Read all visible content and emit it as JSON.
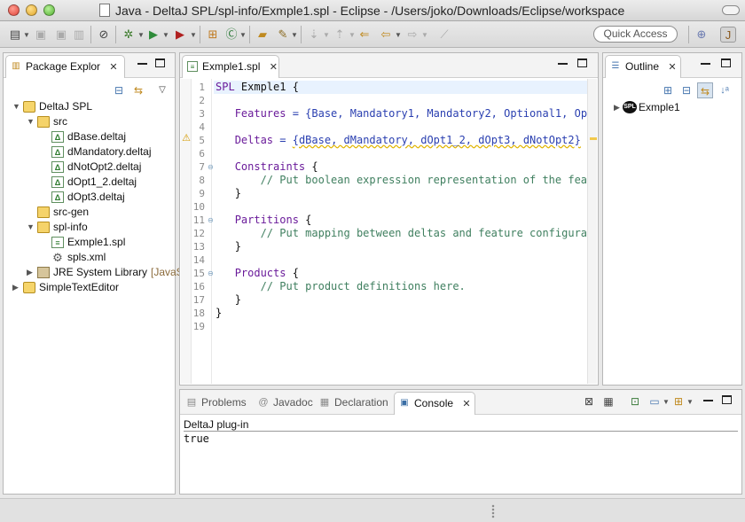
{
  "window": {
    "title": "Java - DeltaJ SPL/spl-info/Exmple1.spl - Eclipse - /Users/joko/Downloads/Eclipse/workspace"
  },
  "toolbar": {
    "quick_access_label": "Quick Access"
  },
  "package_explorer": {
    "tab_label": "Package Explor",
    "tree": [
      {
        "label": "DeltaJ SPL",
        "icon": "project-icon",
        "level": 0,
        "expanded": true
      },
      {
        "label": "src",
        "icon": "source-folder-icon",
        "level": 1,
        "expanded": true
      },
      {
        "label": "dBase.deltaj",
        "icon": "deltaj-file-icon",
        "level": 2
      },
      {
        "label": "dMandatory.deltaj",
        "icon": "deltaj-file-icon",
        "level": 2
      },
      {
        "label": "dNotOpt2.deltaj",
        "icon": "deltaj-file-icon",
        "level": 2
      },
      {
        "label": "dOpt1_2.deltaj",
        "icon": "deltaj-file-icon",
        "level": 2
      },
      {
        "label": "dOpt3.deltaj",
        "icon": "deltaj-file-icon",
        "level": 2
      },
      {
        "label": "src-gen",
        "icon": "source-folder-icon",
        "level": 1
      },
      {
        "label": "spl-info",
        "icon": "source-folder-icon",
        "level": 1,
        "expanded": true
      },
      {
        "label": "Exmple1.spl",
        "icon": "spl-file-icon",
        "level": 2
      },
      {
        "label": "spls.xml",
        "icon": "gear-icon",
        "level": 2
      },
      {
        "label": "JRE System Library",
        "suffix": "[JavaSE",
        "icon": "library-icon",
        "level": 1,
        "collapsed": true
      },
      {
        "label": "SimpleTextEditor",
        "icon": "project-icon",
        "level": 0,
        "collapsed": true
      }
    ]
  },
  "editor": {
    "tab_label": "Exmple1.spl",
    "line_numbers": [
      "1",
      "2",
      "3",
      "4",
      "5",
      "6",
      "7",
      "8",
      "9",
      "10",
      "11",
      "12",
      "13",
      "14",
      "15",
      "16",
      "17",
      "18",
      "19"
    ],
    "lines": {
      "l1_kw": "SPL",
      "l1_rest": " Exmple1 {",
      "l3_kw": "Features",
      "l3_rest": " = {Base, Mandatory1, Mandatory2, Optional1, Opt",
      "l5_kw": "Deltas",
      "l5_eq": " = ",
      "l5_rest": "{dBase, dMandatory, dOpt1_2, dOpt3, dNotOpt2}",
      "l7_kw": "Constraints",
      "l7_rest": " {",
      "l8": "// Put boolean expression representation of the feat",
      "l9": "}",
      "l11_kw": "Partitions",
      "l11_rest": " {",
      "l12": "// Put mapping between deltas and feature configurat",
      "l13": "}",
      "l15_kw": "Products",
      "l15_rest": " {",
      "l16": "// Put product definitions here.",
      "l17": "}",
      "l18": "}"
    }
  },
  "outline": {
    "tab_label": "Outline",
    "root_label": "Exmple1",
    "root_badge": "SPL"
  },
  "bottom": {
    "tabs": [
      "Problems",
      "Javadoc",
      "Declaration",
      "Console"
    ],
    "tab_icons": [
      "problems-icon",
      "javadoc-icon",
      "declaration-icon",
      "console-icon"
    ],
    "console_header": "DeltaJ plug-in",
    "console_output": "true"
  },
  "colors": {
    "keyword": "#6a1b9a",
    "identifier_blue": "#2a3fb0",
    "comment": "#3f7f5f",
    "current_line": "#e8f2fe",
    "warning": "#f2c94c"
  }
}
